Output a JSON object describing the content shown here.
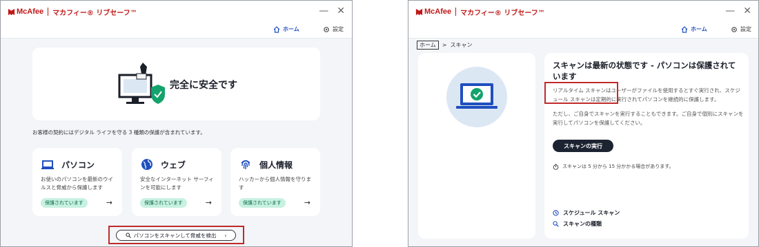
{
  "left": {
    "logo": "McAfee",
    "product": "マカフィー® リブセーフ™",
    "nav": {
      "home": "ホーム",
      "settings": "設定"
    },
    "status": "完全に安全です",
    "description": "お客様の契約にはデジタル ライフを守る 3 種類の保護が含まれています。",
    "cards": [
      {
        "title": "パソコン",
        "desc": "お使いのパソコンを最新のウイルスと脅威から保護します",
        "badge": "保護されています"
      },
      {
        "title": "ウェブ",
        "desc": "安全なインターネット サーフィンを可能にします",
        "badge": "保護されています"
      },
      {
        "title": "個人情報",
        "desc": "ハッカーから個人情報を守ります",
        "badge": "保護されています"
      }
    ],
    "scan_button": "パソコンをスキャンして脅威を検出"
  },
  "right": {
    "logo": "McAfee",
    "product": "マカフィー® リブセーフ™",
    "nav": {
      "home": "ホーム",
      "settings": "設定"
    },
    "breadcrumb": {
      "home": "ホーム",
      "current": "スキャン"
    },
    "title": "スキャンは最新の状態です - パソコンは保護されています",
    "desc1": "リアルタイム スキャンはユーザーがファイルを使用するとすぐ実行され、スケジュール スキャンは定期的に実行されてパソコンを継続的に保護します。",
    "desc2": "ただし、ご自身でスキャンを実行することもできます。ご自身で個別にスキャンを実行してパソコンを保護してください。",
    "run_button": "スキャンの実行",
    "duration": "スキャンは 5 分から 15 分かかる場合があります。",
    "links": {
      "schedule": "スケジュール スキャン",
      "types": "スキャンの種類"
    }
  },
  "colors": {
    "brand": "#c01818",
    "accent": "#1f4fbf",
    "highlight": "#c0292b",
    "badge": "#c8f1e2"
  }
}
